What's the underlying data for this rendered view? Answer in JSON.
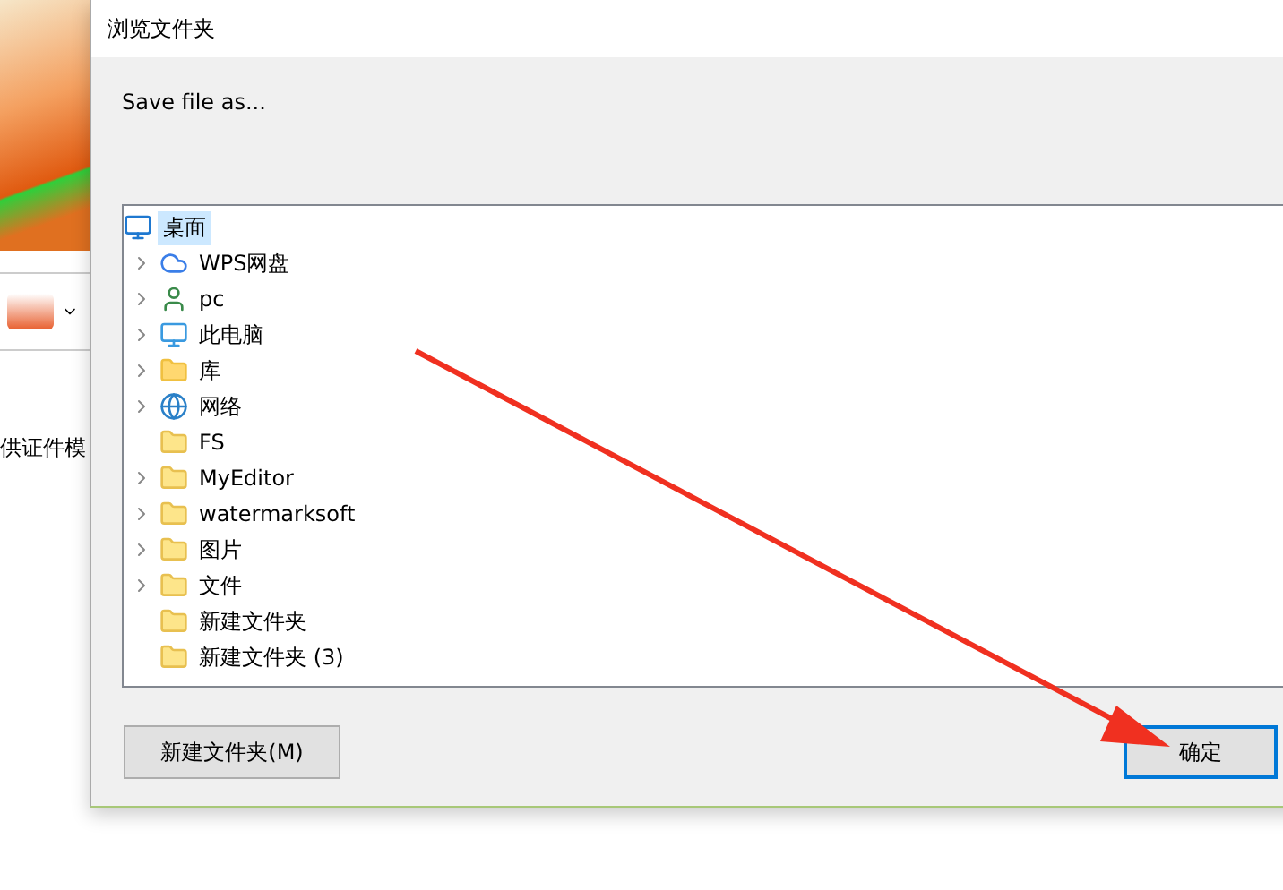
{
  "background_app": {
    "side_text": "供证件模"
  },
  "dialog": {
    "title": "浏览文件夹",
    "prompt": "Save file as...",
    "tree": {
      "label": "桌面",
      "kind": "desktop",
      "selected": true,
      "children": [
        {
          "label": "WPS网盘",
          "kind": "cloud",
          "expandable": true,
          "selected": false
        },
        {
          "label": "pc",
          "kind": "user",
          "expandable": true,
          "selected": false
        },
        {
          "label": "此电脑",
          "kind": "computer",
          "expandable": true,
          "selected": false
        },
        {
          "label": "库",
          "kind": "library",
          "expandable": true,
          "selected": false
        },
        {
          "label": "网络",
          "kind": "network",
          "expandable": true,
          "selected": false
        },
        {
          "label": "FS",
          "kind": "folder",
          "expandable": false,
          "selected": false
        },
        {
          "label": "MyEditor",
          "kind": "folder",
          "expandable": true,
          "selected": false
        },
        {
          "label": "watermarksoft",
          "kind": "folder",
          "expandable": true,
          "selected": false
        },
        {
          "label": "图片",
          "kind": "folder",
          "expandable": true,
          "selected": false
        },
        {
          "label": "文件",
          "kind": "folder",
          "expandable": true,
          "selected": false
        },
        {
          "label": "新建文件夹",
          "kind": "folder",
          "expandable": false,
          "selected": false
        },
        {
          "label": "新建文件夹 (3)",
          "kind": "folder",
          "expandable": false,
          "selected": false
        }
      ]
    },
    "buttons": [
      {
        "label": "新建文件夹(M)",
        "default": false
      },
      {
        "label": "确定",
        "default": true
      }
    ]
  }
}
